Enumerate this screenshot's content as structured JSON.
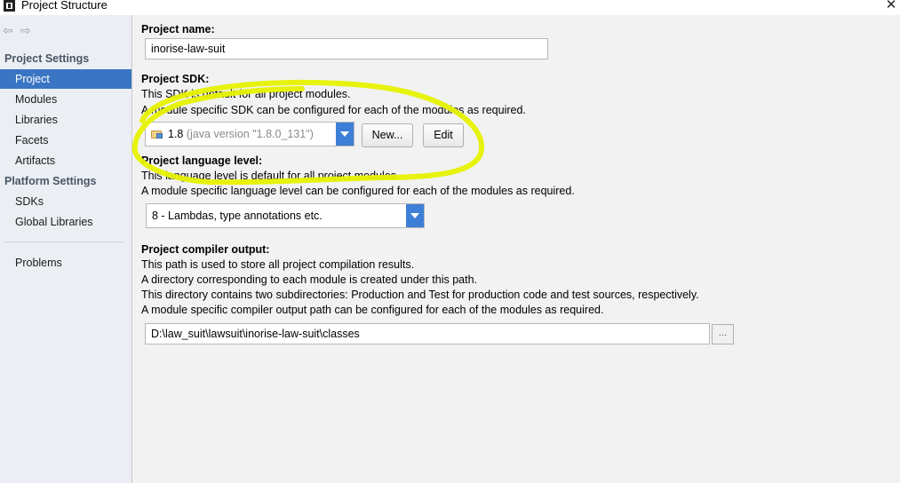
{
  "window": {
    "title": "Project Structure"
  },
  "sidebar": {
    "sections": [
      {
        "label": "Project Settings"
      },
      {
        "label": "Platform Settings"
      }
    ],
    "project_settings_items": [
      "Project",
      "Modules",
      "Libraries",
      "Facets",
      "Artifacts"
    ],
    "platform_settings_items": [
      "SDKs",
      "Global Libraries"
    ],
    "other_items": [
      "Problems"
    ],
    "selected": "Project"
  },
  "main": {
    "project_name": {
      "label": "Project name:",
      "value": "inorise-law-suit"
    },
    "project_sdk": {
      "label": "Project SDK:",
      "desc1": "This SDK is default for all project modules.",
      "desc2": "A module specific SDK can be configured for each of the modules as required.",
      "selected_version": "1.8",
      "selected_detail": "(java version \"1.8.0_131\")",
      "new_button": "New...",
      "edit_button": "Edit"
    },
    "language_level": {
      "label": "Project language level:",
      "desc1": "This language level is default for all project modules.",
      "desc2": "A module specific language level can be configured for each of the modules as required.",
      "selected": "8 - Lambdas, type annotations etc."
    },
    "compiler_output": {
      "label": "Project compiler output:",
      "desc1": "This path is used to store all project compilation results.",
      "desc2": "A directory corresponding to each module is created under this path.",
      "desc3": "This directory contains two subdirectories: Production and Test for production code and test sources, respectively.",
      "desc4": "A module specific compiler output path can be configured for each of the modules as required.",
      "path": "D:\\law_suit\\lawsuit\\inorise-law-suit\\classes",
      "browse_label": "..."
    }
  },
  "annotation": {
    "color": "#e6f200"
  }
}
